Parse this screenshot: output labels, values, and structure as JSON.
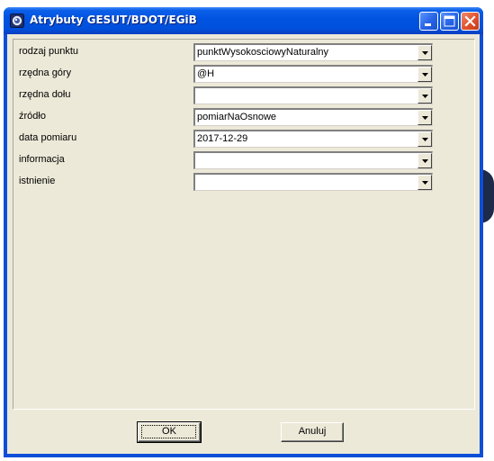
{
  "window": {
    "title": "Atrybuty GESUT/BDOT/EGiB",
    "controls": [
      "minimize-icon",
      "maximize-icon",
      "close-icon"
    ]
  },
  "fields": [
    {
      "label": "rodzaj punktu",
      "value": "punktWysokosciowyNaturalny"
    },
    {
      "label": "rzędna góry",
      "value": "@H"
    },
    {
      "label": "rzędna dołu",
      "value": ""
    },
    {
      "label": "źródło",
      "value": "pomiarNaOsnowe"
    },
    {
      "label": "data pomiaru",
      "value": "2017-12-29"
    },
    {
      "label": "informacja",
      "value": ""
    },
    {
      "label": "istnienie",
      "value": ""
    }
  ],
  "buttons": {
    "ok_label": "OK",
    "cancel_label": "Anuluj"
  },
  "colors": {
    "titlebar": "#0053e0",
    "dialog_face": "#ece9d8",
    "close_button": "#e0512c"
  }
}
